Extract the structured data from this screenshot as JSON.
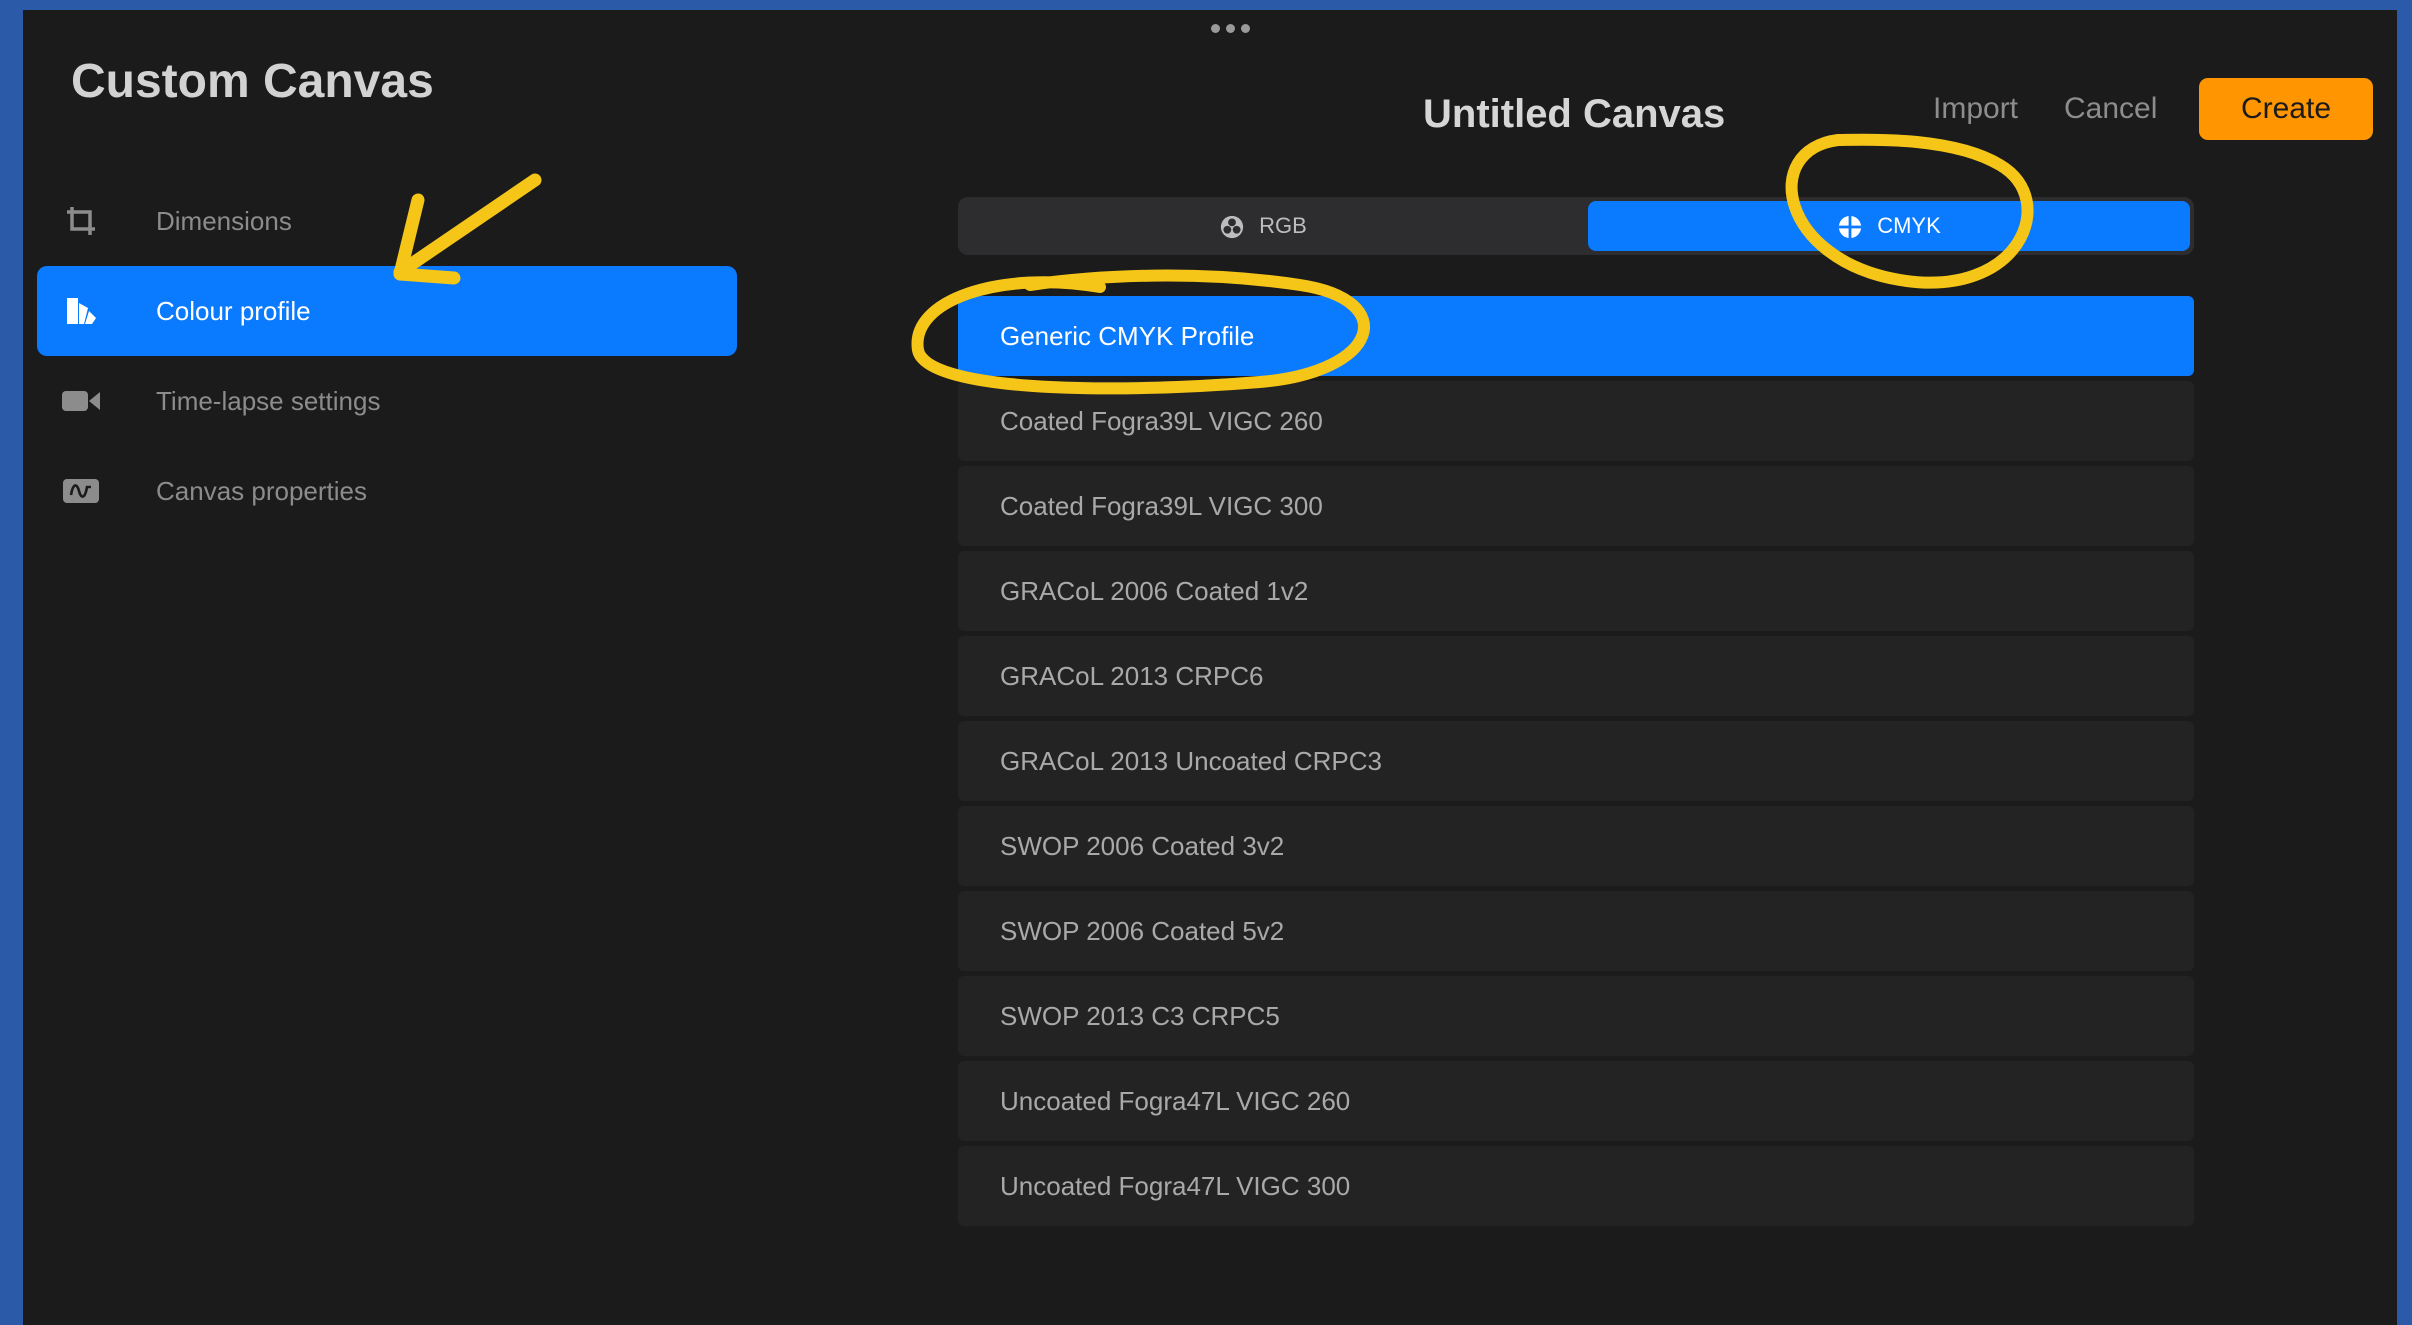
{
  "window": {
    "title": "Custom Canvas",
    "grabber_icon": "more-dots-icon"
  },
  "sidebar": {
    "items": [
      {
        "label": "Dimensions",
        "icon": "crop-icon",
        "active": false
      },
      {
        "label": "Colour profile",
        "icon": "colour-profile-icon",
        "active": true
      },
      {
        "label": "Time-lapse settings",
        "icon": "video-camera-icon",
        "active": false
      },
      {
        "label": "Canvas properties",
        "icon": "properties-icon",
        "active": false
      }
    ]
  },
  "header": {
    "title": "Untitled Canvas",
    "import_label": "Import",
    "cancel_label": "Cancel",
    "create_label": "Create"
  },
  "colour_mode": {
    "segments": [
      {
        "label": "RGB",
        "icon": "rgb-icon",
        "active": false
      },
      {
        "label": "CMYK",
        "icon": "cmyk-icon",
        "active": true
      }
    ]
  },
  "profiles": {
    "items": [
      {
        "label": "Generic CMYK Profile",
        "selected": true
      },
      {
        "label": "Coated Fogra39L VIGC 260",
        "selected": false
      },
      {
        "label": "Coated Fogra39L VIGC 300",
        "selected": false
      },
      {
        "label": "GRACoL 2006 Coated 1v2",
        "selected": false
      },
      {
        "label": "GRACoL 2013 CRPC6",
        "selected": false
      },
      {
        "label": "GRACoL 2013 Uncoated CRPC3",
        "selected": false
      },
      {
        "label": "SWOP 2006 Coated 3v2",
        "selected": false
      },
      {
        "label": "SWOP 2006 Coated 5v2",
        "selected": false
      },
      {
        "label": "SWOP 2013 C3 CRPC5",
        "selected": false
      },
      {
        "label": "Uncoated Fogra47L VIGC 260",
        "selected": false
      },
      {
        "label": "Uncoated Fogra47L VIGC 300",
        "selected": false
      }
    ]
  },
  "colors": {
    "accent": "#0a7aff",
    "create_button": "#ff9500",
    "annotation": "#f5c518",
    "background": "#1b1b1c",
    "frame": "#2a5aa8"
  }
}
